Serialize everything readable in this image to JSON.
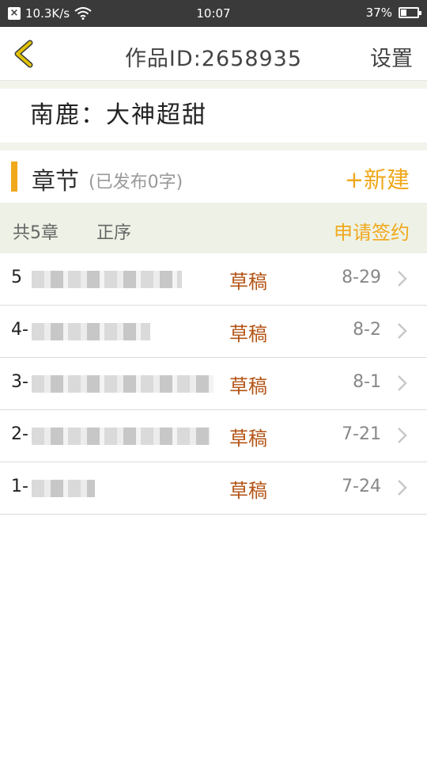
{
  "status_bar": {
    "speed": "10.3K/s",
    "time": "10:07",
    "battery": "37%",
    "battery_level": 0.37
  },
  "header": {
    "title": "作品ID:2658935",
    "settings_label": "设置"
  },
  "book": {
    "name": "南鹿：大神超甜"
  },
  "chapter_section": {
    "title": "章节",
    "published": "(已发布0字)",
    "new_label": "+新建"
  },
  "subbar": {
    "count": "共5章",
    "sort": "正序",
    "sign": "申请签约"
  },
  "chapters": [
    {
      "num": "5",
      "status": "草稿",
      "date": "8-29"
    },
    {
      "num": "4-",
      "status": "草稿",
      "date": "8-2"
    },
    {
      "num": "3-",
      "status": "草稿",
      "date": "8-1"
    },
    {
      "num": "2-",
      "status": "草稿",
      "date": "7-21"
    },
    {
      "num": "1-",
      "status": "草稿",
      "date": "7-24"
    }
  ],
  "colors": {
    "accent": "#f0a81c",
    "status_text": "#b45416",
    "back_arrow": "#e1c200"
  }
}
